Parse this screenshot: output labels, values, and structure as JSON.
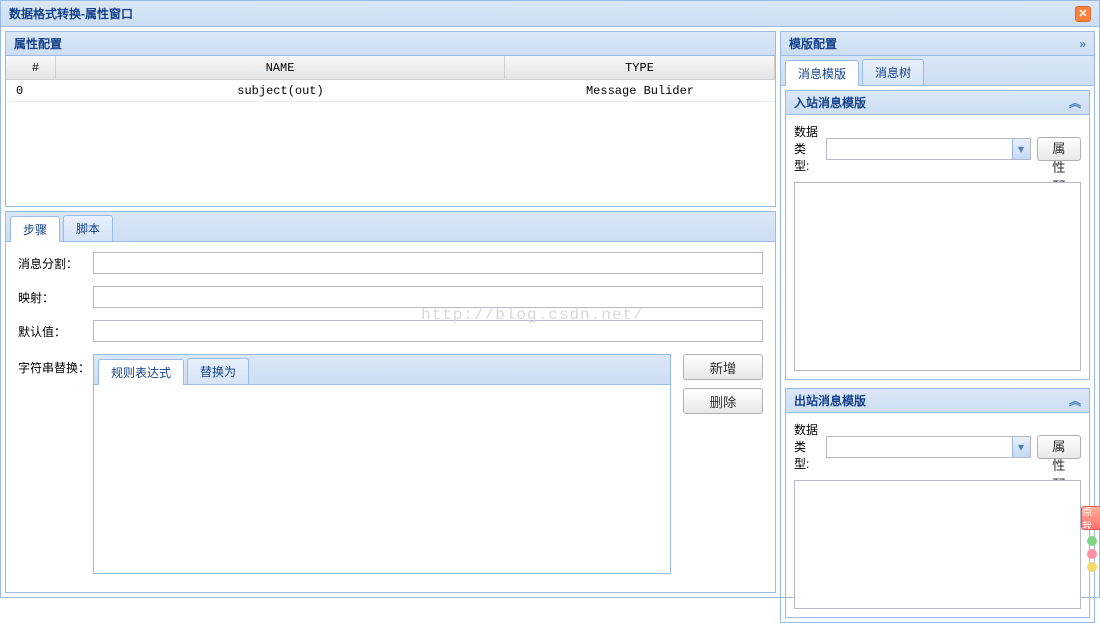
{
  "window": {
    "title": "数据格式转换-属性窗口"
  },
  "left": {
    "panel_top_title": "属性配置",
    "grid": {
      "headers": {
        "idx": "#",
        "name": "NAME",
        "type": "TYPE"
      },
      "rows": [
        {
          "idx": "0",
          "name": "subject(out)",
          "type": "Message Bulider"
        }
      ]
    },
    "bottom_tabs": [
      "步骤",
      "脚本"
    ],
    "bottom_active_tab": 0,
    "form": {
      "msg_split_label": "消息分割：",
      "msg_split_value": "",
      "map_label": "映射：",
      "map_value": "",
      "default_label": "默认值：",
      "default_value": "",
      "replace_label": "字符串替换："
    },
    "inner_tabs": [
      "规则表达式",
      "替换为"
    ],
    "inner_active_tab": 0,
    "buttons": {
      "add": "新增",
      "delete": "删除"
    }
  },
  "right": {
    "panel_title": "模版配置",
    "tabs": [
      "消息模版",
      "消息树"
    ],
    "active_tab": 0,
    "in_panel": {
      "title": "入站消息模版",
      "type_label": "数据类型:",
      "type_value": "",
      "cfg_btn": "属性配置",
      "textarea_value": ""
    },
    "out_panel": {
      "title": "出站消息模版",
      "type_label": "数据类型:",
      "type_value": "",
      "cfg_btn": "属性配置",
      "textarea_value": ""
    }
  },
  "watermark": "http://blog.csdn.net/",
  "side_tag": "点我"
}
